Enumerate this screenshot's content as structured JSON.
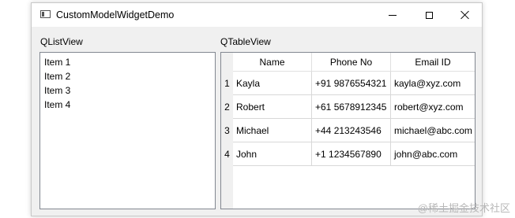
{
  "window": {
    "title": "CustomModelWidgetDemo"
  },
  "list_view": {
    "label": "QListView",
    "items": [
      "Item 1",
      "Item 2",
      "Item 3",
      "Item 4"
    ]
  },
  "table_view": {
    "label": "QTableView",
    "columns": [
      "Name",
      "Phone No",
      "Email ID"
    ],
    "row_numbers": [
      "1",
      "2",
      "3",
      "4"
    ],
    "rows": [
      [
        "Kayla",
        "+91 9876554321",
        "kayla@xyz.com"
      ],
      [
        "Robert",
        "+61 5678912345",
        "robert@xyz.com"
      ],
      [
        "Michael",
        "+44 213243546",
        "michael@abc.com"
      ],
      [
        "John",
        "+1 1234567890",
        "john@abc.com"
      ]
    ]
  },
  "watermark": "@稀土掘金技术社区"
}
